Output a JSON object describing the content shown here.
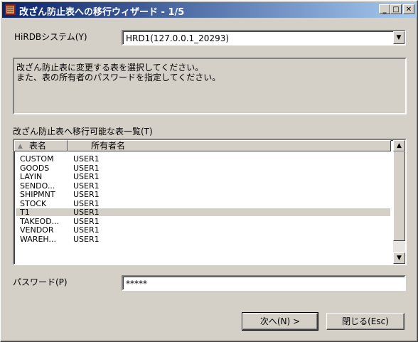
{
  "window": {
    "title": "改ざん防止表への移行ウィザード - 1/5",
    "minimize": "_",
    "maximize": "□",
    "close": "✕"
  },
  "system": {
    "label": "HiRDBシステム(Y)",
    "value": "HRD1(127.0.0.1_20293)"
  },
  "message": {
    "line1": "改ざん防止表に変更する表を選択してください。",
    "line2": "また、表の所有者のパスワードを指定してください。"
  },
  "table_list": {
    "label": "改ざん防止表へ移行可能な表一覧(T)",
    "columns": [
      "表名",
      "所有者名"
    ],
    "rows": [
      {
        "name": "CUSTOM",
        "owner": "USER1"
      },
      {
        "name": "GOODS",
        "owner": "USER1"
      },
      {
        "name": "LAYIN",
        "owner": "USER1"
      },
      {
        "name": "SENDO...",
        "owner": "USER1"
      },
      {
        "name": "SHIPMNT",
        "owner": "USER1"
      },
      {
        "name": "STOCK",
        "owner": "USER1"
      },
      {
        "name": "T1",
        "owner": "USER1"
      },
      {
        "name": "TAKEOD...",
        "owner": "USER1"
      },
      {
        "name": "VENDOR",
        "owner": "USER1"
      },
      {
        "name": "WAREH...",
        "owner": "USER1"
      }
    ],
    "selected_index": 6
  },
  "password": {
    "label": "パスワード(P)",
    "value": "*****"
  },
  "buttons": {
    "next": "次へ(N) >",
    "close": "閉じる(Esc)"
  }
}
